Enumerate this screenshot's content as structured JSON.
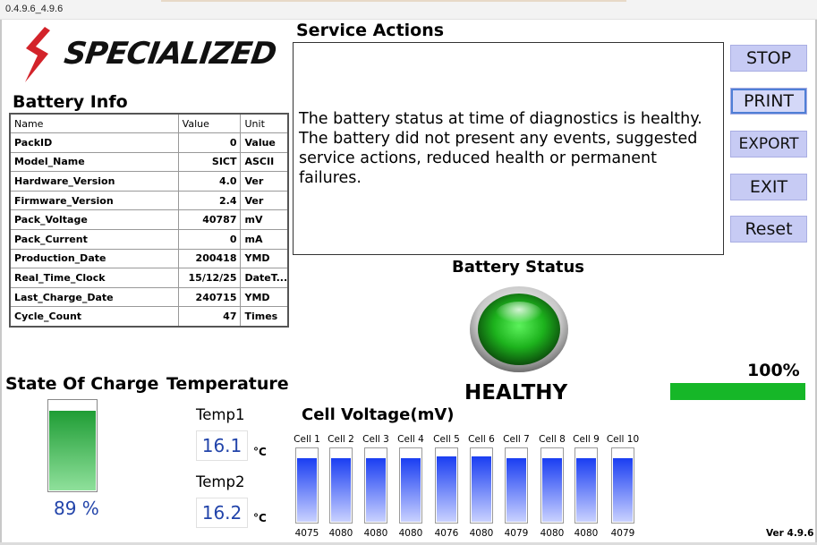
{
  "window": {
    "title": "0.4.9.6_4.9.6"
  },
  "brand": {
    "logo_text": "SPECIALIZED",
    "logo_color": "#d3232a"
  },
  "battery_info": {
    "title": "Battery Info",
    "columns": [
      "Name",
      "Value",
      "Unit"
    ],
    "rows": [
      {
        "name": "PackID",
        "value": "0",
        "unit": "Value"
      },
      {
        "name": "Model_Name",
        "value": "SICT",
        "unit": "ASCII"
      },
      {
        "name": "Hardware_Version",
        "value": "4.0",
        "unit": "Ver"
      },
      {
        "name": "Firmware_Version",
        "value": "2.4",
        "unit": "Ver"
      },
      {
        "name": "Pack_Voltage",
        "value": "40787",
        "unit": "mV"
      },
      {
        "name": "Pack_Current",
        "value": "0",
        "unit": "mA"
      },
      {
        "name": "Production_Date",
        "value": "200418",
        "unit": "YMD"
      },
      {
        "name": "Real_Time_Clock",
        "value": "15/12/25",
        "unit": "DateT..."
      },
      {
        "name": "Last_Charge_Date",
        "value": "240715",
        "unit": "YMD"
      },
      {
        "name": "Cycle_Count",
        "value": "47",
        "unit": "Times"
      }
    ]
  },
  "service_actions": {
    "title": "Service Actions",
    "text": "The battery status at time of diagnostics is healthy. The battery did not present any events, suggested service actions, reduced health or permanent failures."
  },
  "buttons": {
    "stop": "STOP",
    "print": "PRINT",
    "export": "EXPORT",
    "exit": "EXIT",
    "reset": "Reset"
  },
  "battery_status": {
    "title": "Battery Status",
    "status": "HEALTHY",
    "indicator_color": "#1db31d"
  },
  "progress": {
    "label": "100%",
    "value": 1.0,
    "color": "#16b728"
  },
  "state_of_charge": {
    "title": "State Of Charge",
    "label": "89 %",
    "value": 0.89
  },
  "temperature": {
    "title": "Temperature",
    "unit": "°C",
    "sensors": [
      {
        "label": "Temp1",
        "value": "16.1"
      },
      {
        "label": "Temp2",
        "value": "16.2"
      }
    ]
  },
  "cell_voltage": {
    "title": "Cell Voltage(mV)",
    "cells": [
      {
        "name": "Cell 1",
        "value": "4075",
        "level": 0.88
      },
      {
        "name": "Cell 2",
        "value": "4080",
        "level": 0.88
      },
      {
        "name": "Cell 3",
        "value": "4080",
        "level": 0.88
      },
      {
        "name": "Cell 4",
        "value": "4080",
        "level": 0.88
      },
      {
        "name": "Cell 5",
        "value": "4076",
        "level": 0.9
      },
      {
        "name": "Cell 6",
        "value": "4080",
        "level": 0.9
      },
      {
        "name": "Cell 7",
        "value": "4079",
        "level": 0.88
      },
      {
        "name": "Cell 8",
        "value": "4080",
        "level": 0.88
      },
      {
        "name": "Cell 9",
        "value": "4080",
        "level": 0.88
      },
      {
        "name": "Cell 10",
        "value": "4079",
        "level": 0.88
      }
    ]
  },
  "version": {
    "text": "Ver 4.9.6"
  }
}
